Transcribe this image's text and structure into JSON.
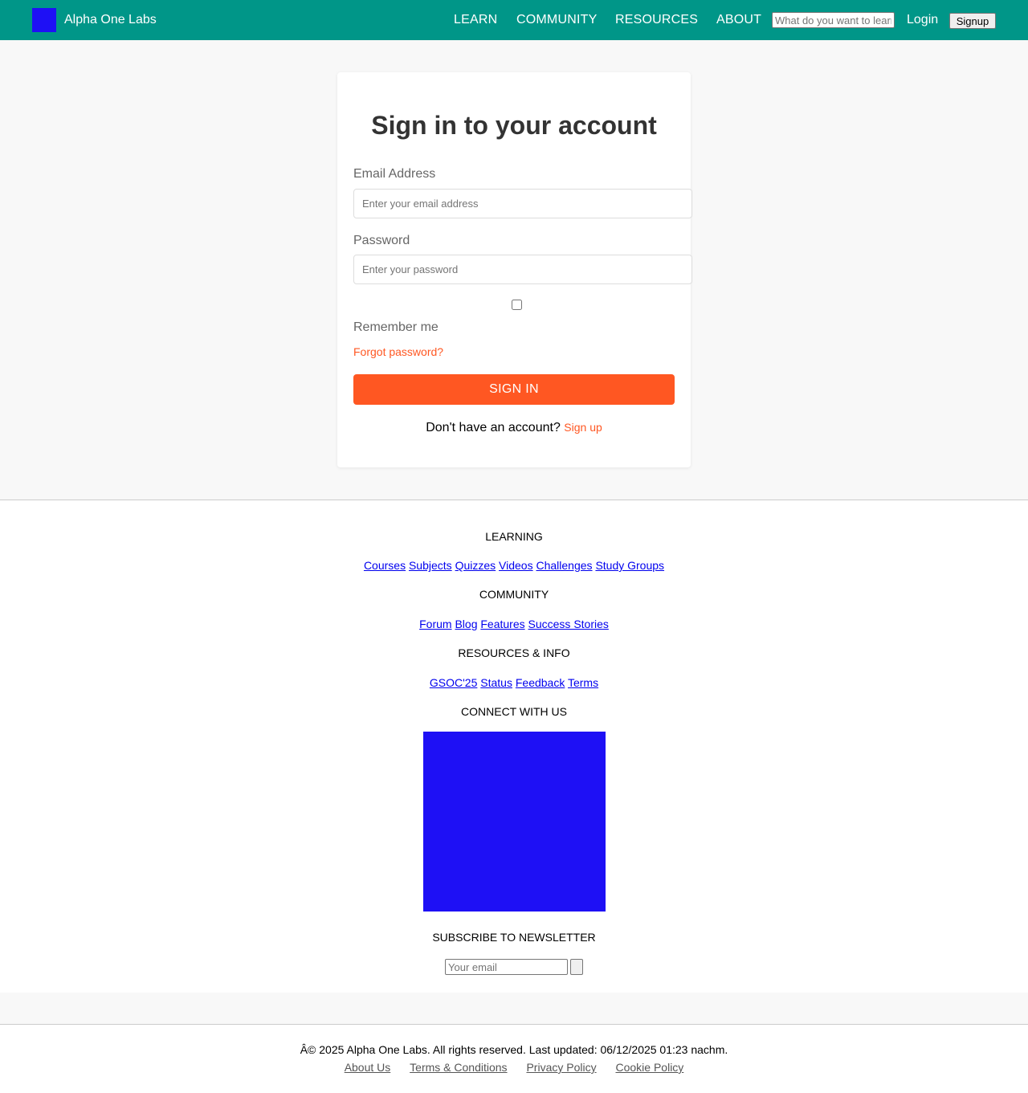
{
  "header": {
    "brand": "Alpha One Labs",
    "nav": [
      "LEARN",
      "COMMUNITY",
      "RESOURCES",
      "ABOUT"
    ],
    "search_placeholder": "What do you want to learn?",
    "login": "Login",
    "signup": "Signup"
  },
  "login_form": {
    "title": "Sign in to your account",
    "email_label": "Email Address",
    "email_placeholder": "Enter your email address",
    "password_label": "Password",
    "password_placeholder": "Enter your password",
    "remember_label": "Remember me",
    "remember_checked": false,
    "forgot_link": "Forgot password?",
    "submit": "SIGN IN",
    "no_account_text": "Don't have an account?",
    "signup_link": "Sign up"
  },
  "footer": {
    "learning_heading": "LEARNING",
    "learning_links": [
      "Courses",
      "Subjects",
      "Quizzes",
      "Videos",
      "Challenges",
      "Study Groups"
    ],
    "community_heading": "COMMUNITY",
    "community_links": [
      "Forum",
      "Blog",
      "Features",
      "Success Stories"
    ],
    "resources_heading": "RESOURCES & INFO",
    "resources_links": [
      "GSOC'25",
      "Status",
      "Feedback",
      "Terms"
    ],
    "connect_heading": "CONNECT WITH US",
    "subscribe_heading": "SUBSCRIBE TO NEWSLETTER",
    "newsletter_placeholder": "Your email",
    "copyright": "Â© 2025 Alpha One Labs. All rights reserved. Last updated: 06/12/2025 01:23 nachm.",
    "legal_links": [
      "About Us",
      "Terms & Conditions",
      "Privacy Policy",
      "Cookie Policy"
    ]
  },
  "colors": {
    "header_bg": "#009688",
    "accent": "#ff5722",
    "placeholder_block": "#1e10f5"
  }
}
